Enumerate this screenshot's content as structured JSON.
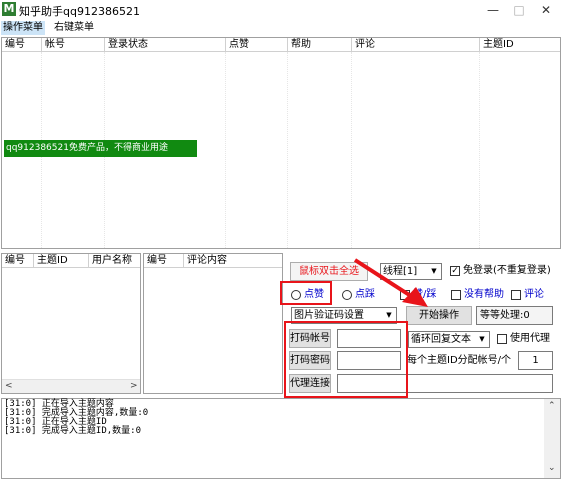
{
  "window": {
    "title": "知乎助手qq912386521",
    "minimize": "—",
    "maximize": "□",
    "close": "✕"
  },
  "menu": [
    {
      "label": "操作菜单"
    },
    {
      "label": "右键菜单"
    }
  ],
  "main_table": {
    "columns": [
      "编号",
      "帐号",
      "登录状态",
      "点赞",
      "帮助",
      "评论",
      "主题ID"
    ],
    "banner": "qq912386521免费产品，不得商业用途"
  },
  "topic_table": {
    "columns": [
      "编号",
      "主题ID",
      "用户名称"
    ]
  },
  "comment_table": {
    "columns": [
      "编号",
      "评论内容"
    ]
  },
  "controls": {
    "select_all_button": "鼠标双击全选",
    "thread_select": "线程[1]",
    "free_login_label": "免登录(不重复登录)",
    "free_login_checked": true,
    "radio_like": "点赞",
    "radio_dislike": "点踩",
    "check_like_dislike": "赞/踩",
    "check_no_help": "没有帮助",
    "check_comment": "评论",
    "captcha_select": "图片验证码设置",
    "start_button": "开始操作",
    "waiting_label": "等等处理:0",
    "captcha_account_label": "打码帐号",
    "captcha_password_label": "打码密码",
    "proxy_link_label": "代理连接",
    "captcha_account_value": "",
    "captcha_password_value": "",
    "proxy_link_value": "",
    "reply_mode_select": "循环回复文本",
    "use_proxy_label": "使用代理",
    "per_topic_label": "每个主题ID分配帐号/个",
    "per_topic_value": "1"
  },
  "log": [
    "[31:0] 正在导入主题内容",
    "[31:0] 完成导入主题内容,数量:0",
    "[31:0] 正在导入主题ID",
    "[31:0] 完成导入主题ID,数量:0"
  ],
  "colors": {
    "banner_bg": "#118a11",
    "highlight": "#e8141a",
    "link_blue": "#0000cc",
    "select_all_text": "#e8141a"
  }
}
